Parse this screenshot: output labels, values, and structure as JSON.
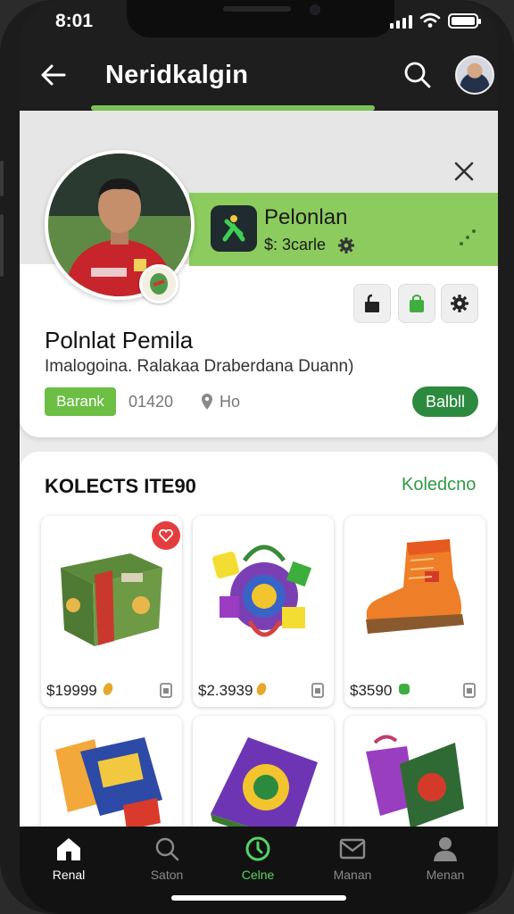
{
  "status": {
    "time": "8:01"
  },
  "app_bar": {
    "title": "Neridkalgin"
  },
  "profile": {
    "panel_title": "Pelonlan",
    "panel_sub": "$: 3carle",
    "name": "Polnlat Pemila",
    "subtitle": "Imalogoina. Ralakaa Draberdana Duann)",
    "tag": "Barank",
    "count": "01420",
    "location": "Ho",
    "action_label": "Balbll"
  },
  "collection": {
    "title": "KOLECTS ITE90",
    "link": "Koledcno",
    "items": [
      {
        "price": "$19999",
        "favorite": true
      },
      {
        "price": "$2.3939"
      },
      {
        "price": "$3590"
      },
      {
        "price": ""
      },
      {
        "price": ""
      },
      {
        "price": ""
      }
    ]
  },
  "nav": {
    "items": [
      {
        "label": "Renal",
        "icon": "home-icon"
      },
      {
        "label": "Saton",
        "icon": "search-icon"
      },
      {
        "label": "Celne",
        "icon": "power-icon"
      },
      {
        "label": "Manan",
        "icon": "mail-icon"
      },
      {
        "label": "Menan",
        "icon": "person-icon"
      }
    ]
  },
  "colors": {
    "brand_green": "#8ccc5e",
    "dark_green": "#2c8a3e",
    "app_bar": "#1e1e1e",
    "favorite": "#e43d3d"
  }
}
